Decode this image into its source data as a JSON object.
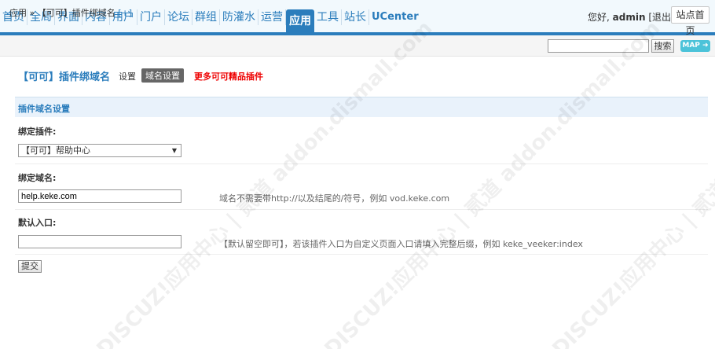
{
  "nav": {
    "items": [
      "首页",
      "全局",
      "界面",
      "内容",
      "用户",
      "门户",
      "论坛",
      "群组",
      "防灌水",
      "运营",
      "应用",
      "工具",
      "站长",
      "UCenter"
    ],
    "active": "应用"
  },
  "user": {
    "greeting": "您好,",
    "name": "admin",
    "logout": "[退出]",
    "home_button": "站点首页"
  },
  "breadcrumb": {
    "text": "应用 » 【可可】插件绑域名",
    "add": "[+]"
  },
  "search": {
    "value": "",
    "button": "搜索",
    "map": "MAP ➜"
  },
  "page": {
    "title": "【可可】插件绑域名",
    "tab_settings": "设置",
    "tab_domain": "域名设置",
    "more_link": "更多可可精品插件"
  },
  "section": {
    "title": "插件域名设置"
  },
  "form": {
    "plugin_label": "绑定插件:",
    "plugin_selected": "【可可】帮助中心",
    "domain_label": "绑定域名:",
    "domain_value": "help.keke.com",
    "domain_hint": "域名不需要带http://以及结尾的/符号，例如 vod.keke.com",
    "entry_label": "默认入口:",
    "entry_value": "",
    "entry_hint": "【默认留空即可】，若该插件入口为自定义页面入口请填入完整后缀，例如 keke_veeker:index",
    "submit": "提交"
  },
  "watermark": "DISCUZ!应用中心 | 贰道 addon.dismall.com"
}
